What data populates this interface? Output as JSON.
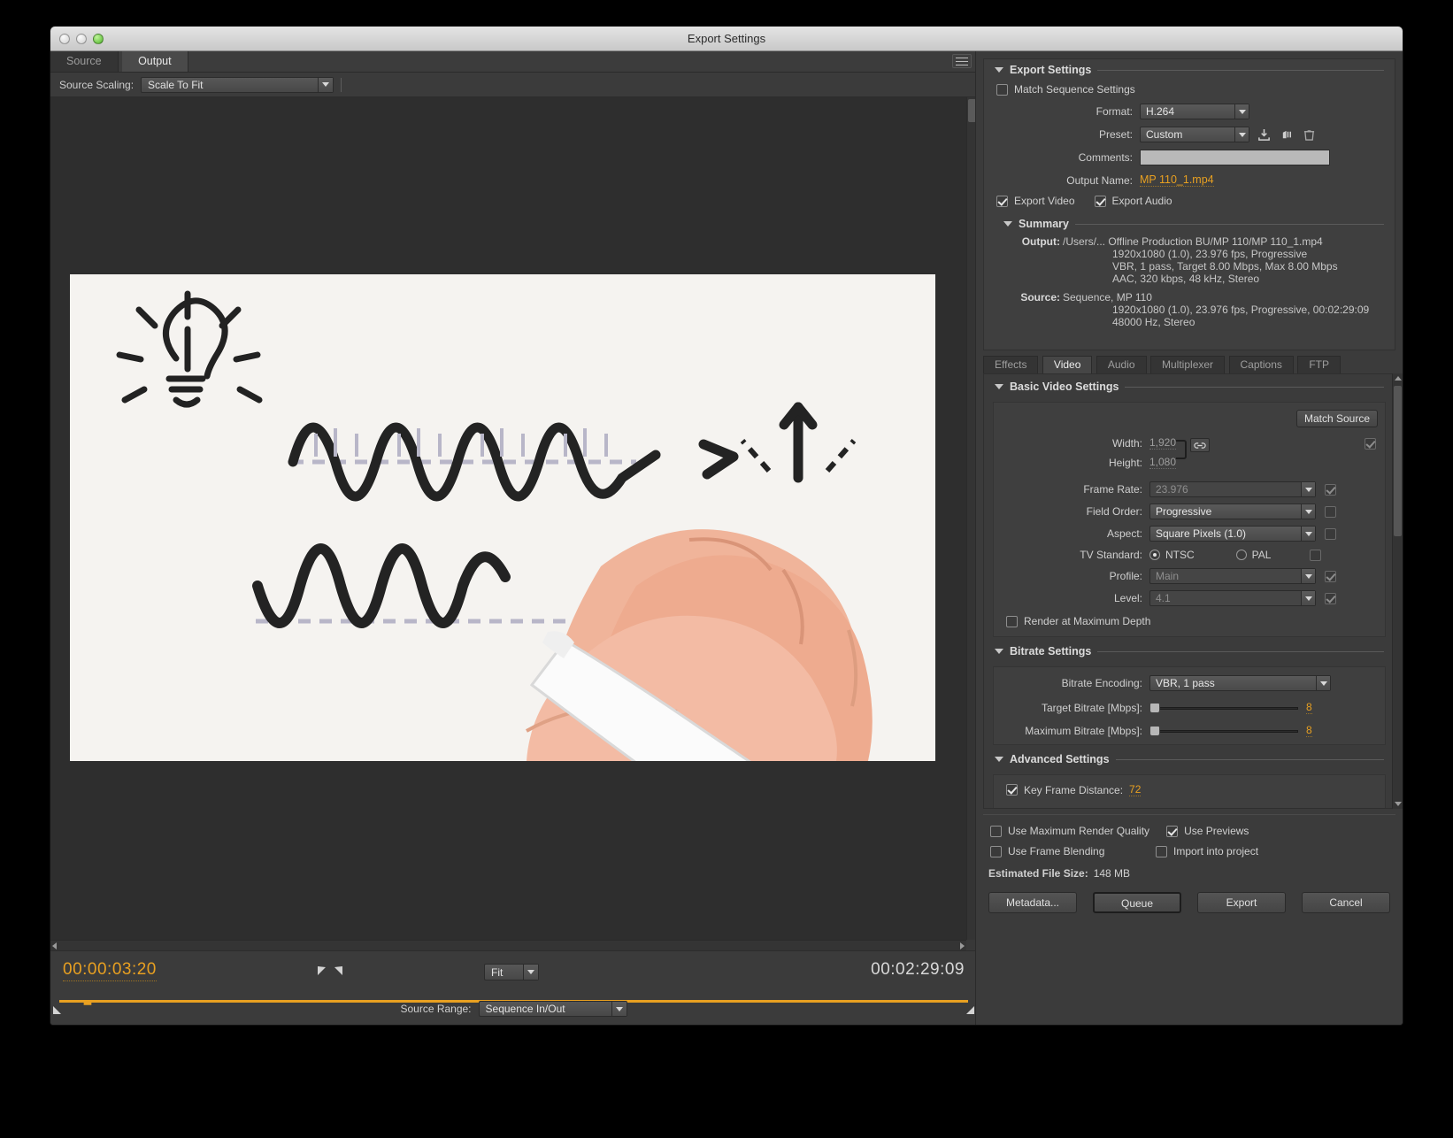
{
  "window": {
    "title": "Export Settings"
  },
  "left": {
    "tabs": [
      {
        "label": "Source",
        "active": false
      },
      {
        "label": "Output",
        "active": true
      }
    ],
    "source_scaling": {
      "label": "Source Scaling:",
      "value": "Scale To Fit"
    },
    "playback": {
      "current_timecode": "00:00:03:20",
      "duration_timecode": "00:02:29:09",
      "zoom_level": "Fit"
    },
    "source_range": {
      "label": "Source Range:",
      "value": "Sequence In/Out"
    }
  },
  "right": {
    "export_settings": {
      "title": "Export Settings",
      "match_sequence_settings": {
        "label": "Match Sequence Settings",
        "checked": false
      },
      "format": {
        "label": "Format:",
        "value": "H.264"
      },
      "preset": {
        "label": "Preset:",
        "value": "Custom"
      },
      "comments": {
        "label": "Comments:",
        "value": "",
        "placeholder": ""
      },
      "output_name": {
        "label": "Output Name:",
        "value": "MP 110_1.mp4"
      },
      "export_video": {
        "label": "Export Video",
        "checked": true
      },
      "export_audio": {
        "label": "Export Audio",
        "checked": true
      },
      "preset_icons": [
        "save-preset-icon",
        "import-preset-icon",
        "delete-preset-icon"
      ]
    },
    "summary": {
      "title": "Summary",
      "output_label": "Output:",
      "output_lines": [
        "/Users/... Offline Production BU/MP 110/MP 110_1.mp4",
        "1920x1080 (1.0), 23.976 fps, Progressive",
        "VBR, 1 pass, Target 8.00 Mbps, Max 8.00 Mbps",
        "AAC, 320 kbps, 48 kHz, Stereo"
      ],
      "source_label": "Source:",
      "source_lines": [
        "Sequence, MP 110",
        "1920x1080 (1.0), 23.976 fps, Progressive, 00:02:29:09",
        "48000 Hz, Stereo"
      ]
    },
    "tabs": [
      {
        "label": "Effects",
        "active": false
      },
      {
        "label": "Video",
        "active": true
      },
      {
        "label": "Audio",
        "active": false
      },
      {
        "label": "Multiplexer",
        "active": false
      },
      {
        "label": "Captions",
        "active": false
      },
      {
        "label": "FTP",
        "active": false
      }
    ],
    "basic_video_settings": {
      "title": "Basic Video Settings",
      "match_source_button": "Match Source",
      "width": {
        "label": "Width:",
        "value": "1,920",
        "checked": true
      },
      "height": {
        "label": "Height:",
        "value": "1,080"
      },
      "frame_rate": {
        "label": "Frame Rate:",
        "value": "23.976",
        "checked": true
      },
      "field_order": {
        "label": "Field Order:",
        "value": "Progressive",
        "checked": false
      },
      "aspect": {
        "label": "Aspect:",
        "value": "Square Pixels (1.0)",
        "checked": false
      },
      "tv_standard": {
        "label": "TV Standard:",
        "ntsc": "NTSC",
        "pal": "PAL",
        "selected": "NTSC",
        "checked": false
      },
      "profile": {
        "label": "Profile:",
        "value": "Main",
        "checked": true
      },
      "level": {
        "label": "Level:",
        "value": "4.1",
        "checked": true
      },
      "render_max_depth": {
        "label": "Render at Maximum Depth",
        "checked": false
      }
    },
    "bitrate_settings": {
      "title": "Bitrate Settings",
      "bitrate_encoding": {
        "label": "Bitrate Encoding:",
        "value": "VBR, 1 pass"
      },
      "target_bitrate": {
        "label": "Target Bitrate [Mbps]:",
        "value": "8"
      },
      "maximum_bitrate": {
        "label": "Maximum Bitrate [Mbps]:",
        "value": "8"
      }
    },
    "advanced_settings": {
      "title": "Advanced Settings",
      "key_frame_distance": {
        "label": "Key Frame Distance:",
        "value": "72",
        "checked": true
      }
    },
    "footer": {
      "use_max_render_quality": {
        "label": "Use Maximum Render Quality",
        "checked": false
      },
      "use_previews": {
        "label": "Use Previews",
        "checked": true
      },
      "use_frame_blending": {
        "label": "Use Frame Blending",
        "checked": false
      },
      "import_into_project": {
        "label": "Import into project",
        "checked": false
      },
      "estimated_file_size": {
        "label": "Estimated File Size:",
        "value": "148 MB"
      },
      "buttons": {
        "metadata": "Metadata...",
        "queue": "Queue",
        "export": "Export",
        "cancel": "Cancel"
      }
    }
  },
  "colors": {
    "accent_orange": "#e8a021",
    "panel_bg": "#3b3b3b",
    "text": "#d0d0d0"
  }
}
